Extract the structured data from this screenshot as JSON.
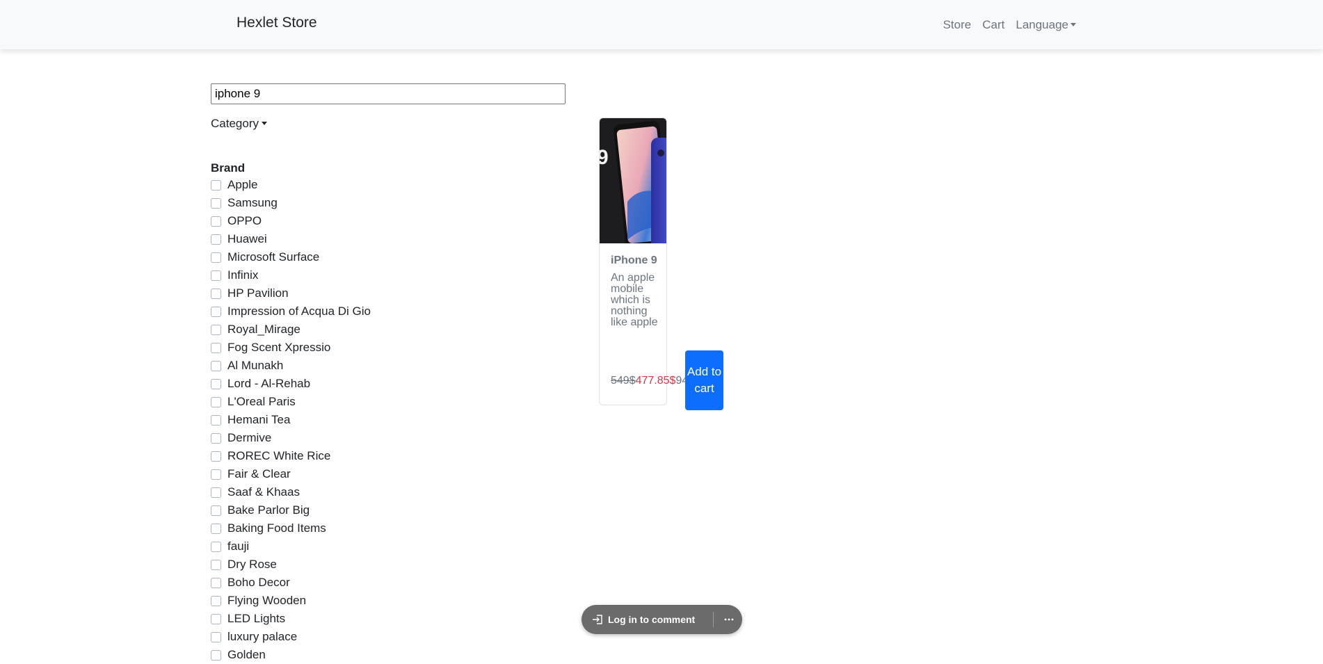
{
  "navbar": {
    "brand": "Hexlet Store",
    "links": [
      "Store",
      "Cart"
    ],
    "language_label": "Language"
  },
  "search": {
    "value": "iphone 9"
  },
  "filters": {
    "category_label": "Category",
    "brand_title": "Brand",
    "brands": [
      "Apple",
      "Samsung",
      "OPPO",
      "Huawei",
      "Microsoft Surface",
      "Infinix",
      "HP Pavilion",
      "Impression of Acqua Di Gio",
      "Royal_Mirage",
      "Fog Scent Xpressio",
      "Al Munakh",
      "Lord - Al-Rehab",
      "L'Oreal Paris",
      "Hemani Tea",
      "Dermive",
      "ROREC White Rice",
      "Fair & Clear",
      "Saaf & Khaas",
      "Bake Parlor Big",
      "Baking Food Items",
      "fauji",
      "Dry Rose",
      "Boho Decor",
      "Flying Wooden",
      "LED Lights",
      "luxury palace",
      "Golden"
    ]
  },
  "product": {
    "title": "iPhone 9",
    "description": "An apple mobile which is nothing like apple",
    "old_price": "549$",
    "new_price": "477.85$",
    "extra": "94",
    "add_to_cart": "Add to cart"
  },
  "comment_bar": {
    "label": "Log in to comment"
  },
  "colors": {
    "primary": "#0d6efd",
    "danger": "#dc3545",
    "muted": "#6c757d",
    "navbar_bg": "#f8f9fa"
  }
}
